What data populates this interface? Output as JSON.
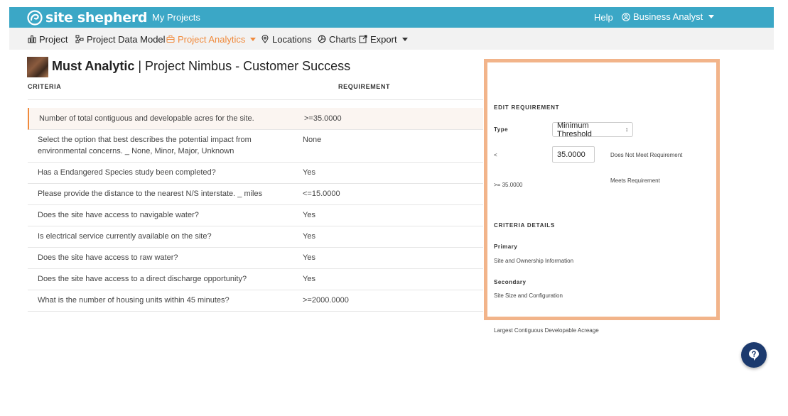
{
  "header": {
    "logo_text": "site shepherd",
    "my_projects": "My Projects",
    "help": "Help",
    "user": "Business Analyst"
  },
  "toolbar": {
    "project": "Project",
    "data_model": "Project Data Model",
    "analytics": "Project Analytics",
    "locations": "Locations",
    "charts": "Charts",
    "export": "Export"
  },
  "page": {
    "title_bold": "Must Analytic",
    "title_rest": " | Project Nimbus - Customer Success"
  },
  "table": {
    "headers": {
      "criteria": "CRITERIA",
      "requirement": "REQUIREMENT"
    },
    "rows": [
      {
        "criteria": "Number of total contiguous and developable acres for the site.",
        "requirement": ">=35.0000"
      },
      {
        "criteria": "Select the option that best describes the potential impact from environmental concerns. _ None, Minor, Major, Unknown",
        "requirement": "None"
      },
      {
        "criteria": "Has a Endangered Species study been completed?",
        "requirement": "Yes"
      },
      {
        "criteria": "Please provide the distance to the nearest N/S interstate. _ miles",
        "requirement": "<=15.0000"
      },
      {
        "criteria": "Does the site have access to navigable water?",
        "requirement": "Yes"
      },
      {
        "criteria": "Is electrical service currently available on the site?",
        "requirement": "Yes"
      },
      {
        "criteria": "Does the site have access to raw water?",
        "requirement": "Yes"
      },
      {
        "criteria": "Does the site have access to a direct discharge opportunity?",
        "requirement": "Yes"
      },
      {
        "criteria": "What is the number of housing units within 45 minutes?",
        "requirement": ">=2000.0000"
      }
    ]
  },
  "panel": {
    "edit_heading": "EDIT REQUIREMENT",
    "type_label": "Type",
    "type_value": "Minimum Threshold",
    "lt_label": "<",
    "value": "35.0000",
    "not_meet": "Does Not Meet Requirement",
    "gte_label": ">= 35.0000",
    "meets": "Meets Requirement",
    "details_heading": "CRITERIA DETAILS",
    "primary_label": "Primary",
    "primary_value": "Site and Ownership Information",
    "secondary_label": "Secondary",
    "secondary_value": "Site Size and Configuration",
    "tertiary_value": "Largest Contiguous Developable Acreage"
  },
  "colors": {
    "brand": "#3ba7c6",
    "active": "#f08a3c",
    "panel_border": "#f2b48a",
    "fab": "#1c3a6e"
  }
}
